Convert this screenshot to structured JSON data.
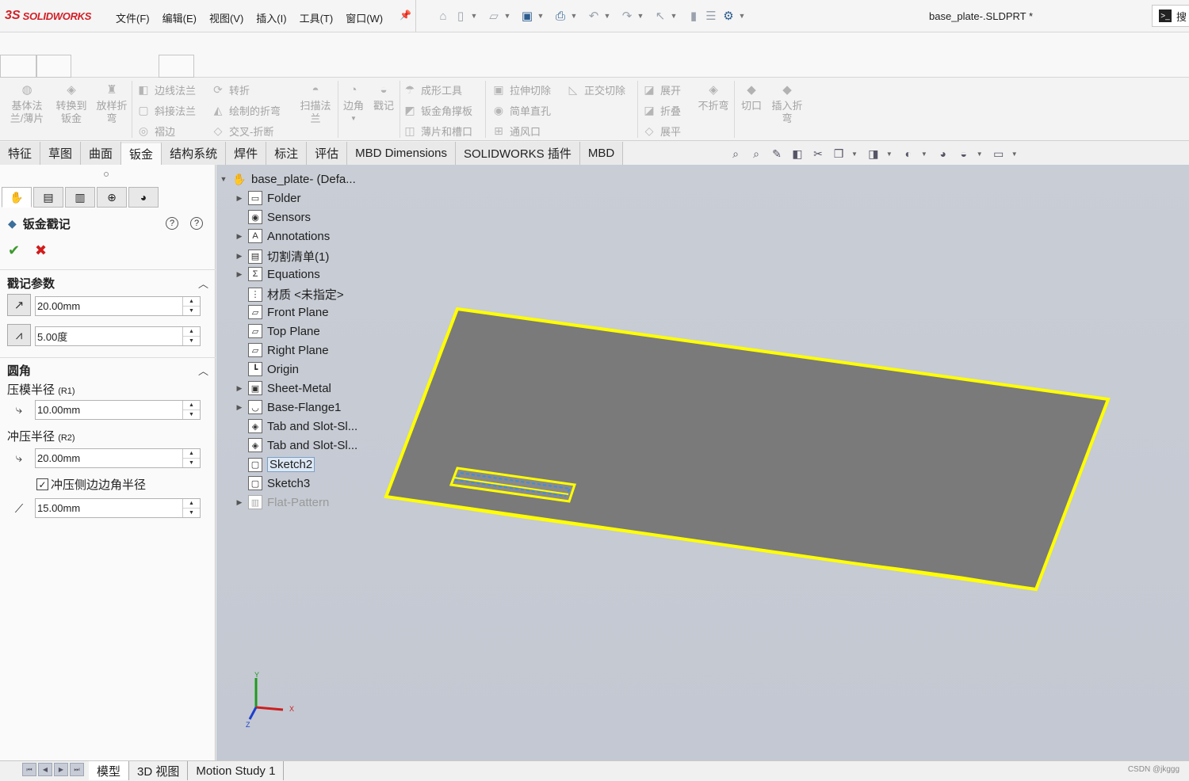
{
  "app": {
    "logo_mark": "3S",
    "logo_text": "SOLIDWORKS",
    "document_title": "base_plate-.SLDPRT *",
    "search_hint": "搜"
  },
  "menu": [
    "文件(F)",
    "编辑(E)",
    "视图(V)",
    "插入(I)",
    "工具(T)",
    "窗口(W)"
  ],
  "quick_access_icons": [
    "home-icon",
    "new-icon",
    "open-icon",
    "save-icon",
    "print-icon",
    "undo-icon",
    "redo-icon",
    "select-icon",
    "rebuild-icon",
    "file-properties-icon",
    "options-icon"
  ],
  "ribbon": {
    "big": [
      {
        "label": "基体法\n兰/薄片"
      },
      {
        "label": "转换到\n钣金"
      },
      {
        "label": "放样折\n弯"
      },
      {
        "label": "扫描法\n兰"
      },
      {
        "label": "边角"
      },
      {
        "label": "戳记"
      },
      {
        "label": "不折弯"
      },
      {
        "label": "切口"
      },
      {
        "label": "插入折\n弯"
      }
    ],
    "rows": {
      "col1": [
        "边线法兰",
        "斜接法兰",
        "褶边"
      ],
      "col2": [
        "转折",
        "绘制的折弯",
        "交叉-折断"
      ],
      "col3": [
        "成形工具",
        "钣金角撑板",
        "薄片和槽口"
      ],
      "col4": [
        "拉伸切除",
        "简单直孔",
        "通风口"
      ],
      "col5": [
        "正交切除"
      ],
      "col6": [
        "展开",
        "折叠",
        "展平"
      ]
    }
  },
  "tabs": [
    "特征",
    "草图",
    "曲面",
    "钣金",
    "结构系统",
    "焊件",
    "标注",
    "评估",
    "MBD Dimensions",
    "SOLIDWORKS 插件",
    "MBD"
  ],
  "active_tab": "钣金",
  "property_manager": {
    "title": "钣金戳记",
    "help1": "?",
    "help2": "?",
    "ok": "✔",
    "cancel": "✖",
    "section1": {
      "title": "戳记参数",
      "distance": "20.00mm",
      "angle": "5.00度"
    },
    "section2": {
      "title": "圆角",
      "die_radius_label": "压模半径",
      "die_radius_tag": "(R1)",
      "die_radius": "10.00mm",
      "punch_radius_label": "冲压半径",
      "punch_radius_tag": "(R2)",
      "punch_radius": "20.00mm",
      "checkbox_label": "冲压侧边边角半径",
      "checkbox_checked": true,
      "corner_radius": "15.00mm"
    }
  },
  "feature_tree": {
    "root": "base_plate- (Defa...",
    "items": [
      {
        "label": "Folder",
        "expandable": true,
        "icon": "folder-icon"
      },
      {
        "label": "Sensors",
        "expandable": false,
        "icon": "sensor-icon"
      },
      {
        "label": "Annotations",
        "expandable": true,
        "icon": "annotation-icon"
      },
      {
        "label": "切割清单(1)",
        "expandable": true,
        "icon": "cut-list-icon"
      },
      {
        "label": "Equations",
        "expandable": true,
        "icon": "equation-icon"
      },
      {
        "label": "材质 <未指定>",
        "expandable": false,
        "icon": "material-icon"
      },
      {
        "label": "Front Plane",
        "expandable": false,
        "icon": "plane-icon"
      },
      {
        "label": "Top Plane",
        "expandable": false,
        "icon": "plane-icon"
      },
      {
        "label": "Right Plane",
        "expandable": false,
        "icon": "plane-icon"
      },
      {
        "label": "Origin",
        "expandable": false,
        "icon": "origin-icon"
      },
      {
        "label": "Sheet-Metal",
        "expandable": true,
        "icon": "sheet-metal-icon"
      },
      {
        "label": "Base-Flange1",
        "expandable": true,
        "icon": "base-flange-icon"
      },
      {
        "label": "Tab and Slot-Sl...",
        "expandable": false,
        "icon": "tab-slot-icon"
      },
      {
        "label": "Tab and Slot-Sl...",
        "expandable": false,
        "icon": "tab-slot-icon"
      },
      {
        "label": "Sketch2",
        "expandable": false,
        "icon": "sketch-icon",
        "selected": true
      },
      {
        "label": "Sketch3",
        "expandable": false,
        "icon": "sketch-icon"
      },
      {
        "label": "Flat-Pattern",
        "expandable": true,
        "icon": "flat-pattern-icon",
        "faded": true
      }
    ]
  },
  "triad": {
    "x": "X",
    "y": "Y",
    "z": "Z"
  },
  "bottom_tabs": [
    "模型",
    "3D 视图",
    "Motion Study 1"
  ],
  "active_bottom_tab": "模型",
  "watermark": "CSDN @jkggg",
  "colors": {
    "highlight": "#ffff00",
    "plate": "#7a7a7a",
    "selection": "#3a8fd8"
  }
}
